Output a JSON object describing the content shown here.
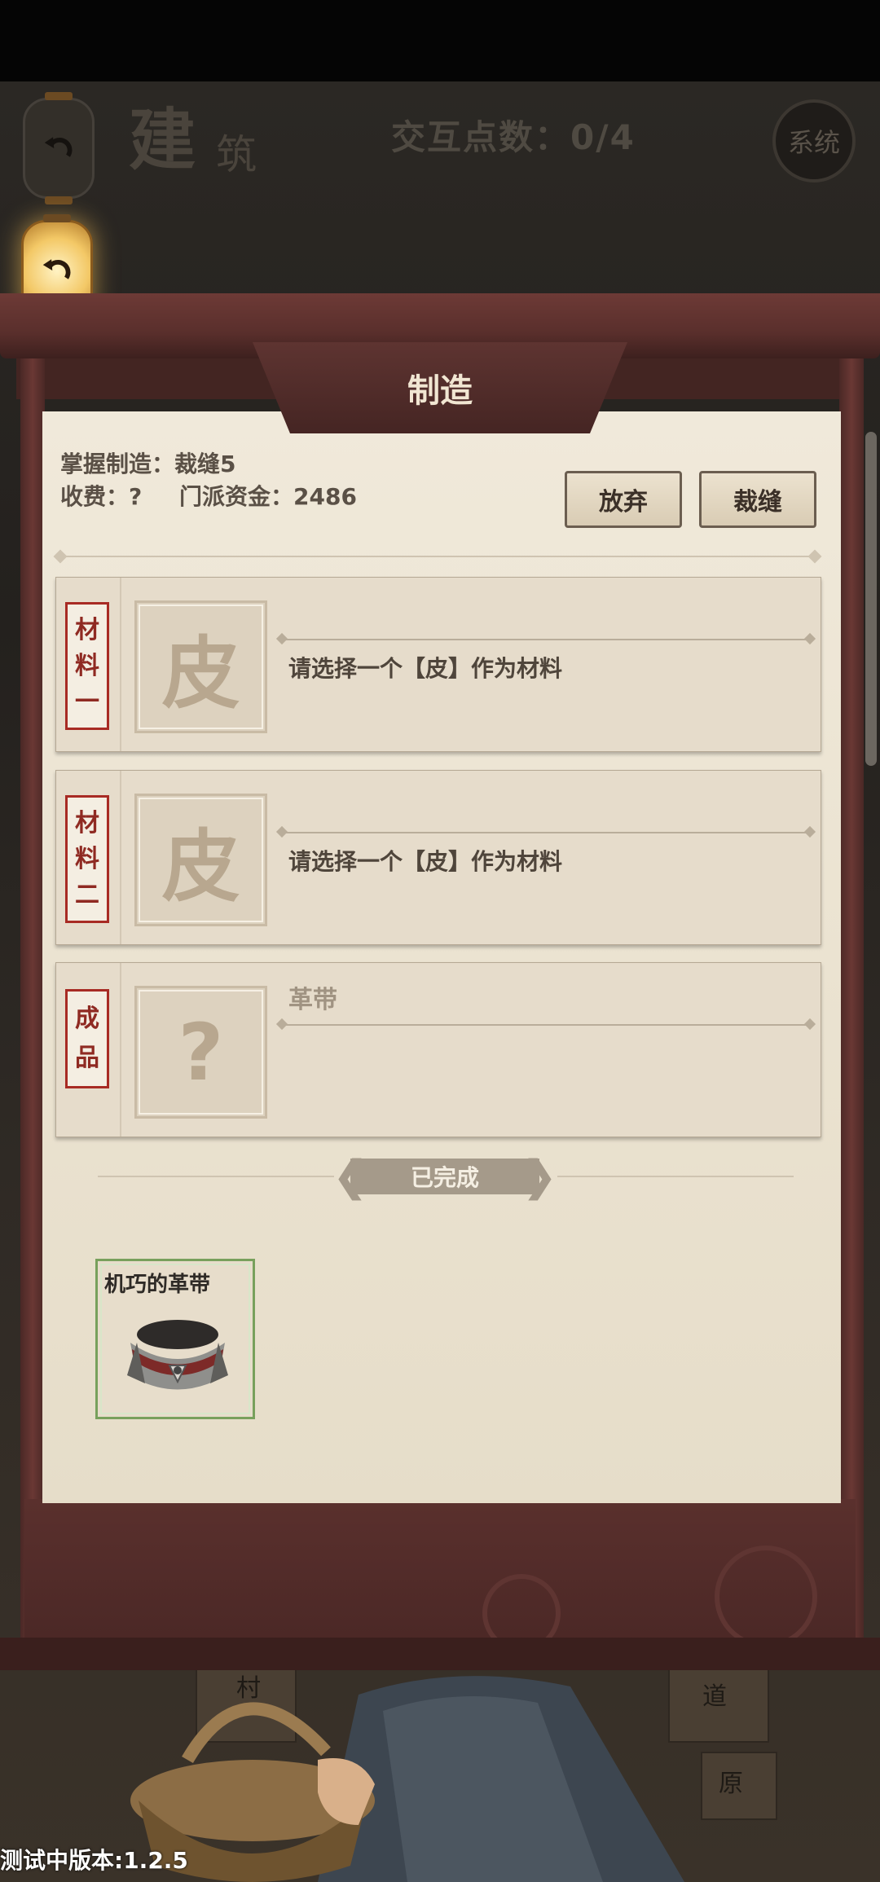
{
  "top_bar": {
    "title_main": "建",
    "title_sub": "筑",
    "interaction_counter": "交互点数：0/4",
    "system_label": "系统"
  },
  "panel": {
    "title": "制造",
    "mastered_craft": "掌握制造：裁缝5",
    "fee": "收费：?",
    "sect_funds": "门派资金：2486",
    "buttons": {
      "abandon": "放弃",
      "tailor": "裁缝"
    }
  },
  "materials": [
    {
      "tag": [
        "材",
        "料",
        "一"
      ],
      "slot_glyph": "皮",
      "prompt": "请选择一个【皮】作为材料"
    },
    {
      "tag": [
        "材",
        "料",
        "二"
      ],
      "slot_glyph": "皮",
      "prompt": "请选择一个【皮】作为材料"
    }
  ],
  "product": {
    "tag": [
      "成",
      "品"
    ],
    "slot_glyph": "?",
    "name": "革带"
  },
  "completed": {
    "banner": "已完成",
    "items": [
      {
        "name": "机巧的革带",
        "icon": "leather-belt-icon"
      }
    ]
  },
  "background": {
    "tile_1": "村",
    "tile_2": "道",
    "tile_3": "原"
  },
  "version": "测试中版本:1.2.5",
  "colors": {
    "frame": "#5a2f2c",
    "parchment": "#ebe3d1",
    "tag_red": "#a82b24",
    "item_border": "#78a05c"
  }
}
